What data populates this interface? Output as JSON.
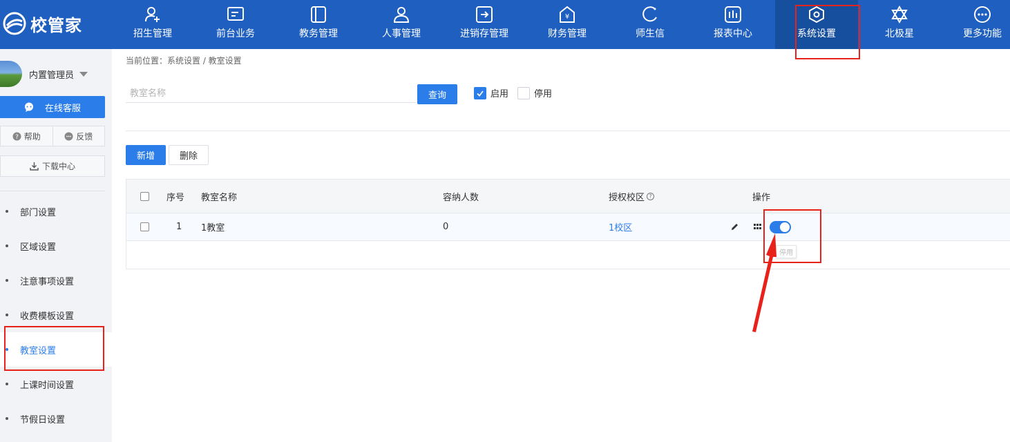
{
  "app": {
    "logo_text": "校管家"
  },
  "nav": [
    {
      "label": "招生管理",
      "icon": "user-add-icon"
    },
    {
      "label": "前台业务",
      "icon": "screen-icon"
    },
    {
      "label": "教务管理",
      "icon": "book-icon"
    },
    {
      "label": "人事管理",
      "icon": "person-icon"
    },
    {
      "label": "进销存管理",
      "icon": "arrow-box-icon"
    },
    {
      "label": "财务管理",
      "icon": "yuan-house-icon"
    },
    {
      "label": "师生信",
      "icon": "chat-circle-icon"
    },
    {
      "label": "报表中心",
      "icon": "bar-chart-icon"
    },
    {
      "label": "系统设置",
      "icon": "hexagon-gear-icon",
      "active": true
    },
    {
      "label": "北极星",
      "icon": "star-of-david-icon"
    },
    {
      "label": "更多功能",
      "icon": "more-dots-icon"
    }
  ],
  "sidebar": {
    "user_name": "内置管理员",
    "service_label": "在线客服",
    "help_label": "帮助",
    "feedback_label": "反馈",
    "download_label": "下载中心",
    "menu": [
      {
        "label": "部门设置"
      },
      {
        "label": "区域设置"
      },
      {
        "label": "注意事项设置"
      },
      {
        "label": "收费模板设置"
      },
      {
        "label": "教室设置",
        "active": true
      },
      {
        "label": "上课时间设置"
      },
      {
        "label": "节假日设置"
      }
    ]
  },
  "breadcrumb": "当前位置：系统设置 / 教室设置",
  "search": {
    "placeholder": "教室名称",
    "value": "",
    "query_label": "查询"
  },
  "filters": {
    "enabled_label": "启用",
    "enabled_checked": true,
    "disabled_label": "停用",
    "disabled_checked": false
  },
  "toolbar": {
    "add_label": "新增",
    "delete_label": "删除"
  },
  "table": {
    "columns": [
      "序号",
      "教室名称",
      "容纳人数",
      "授权校区",
      "操作"
    ],
    "rows": [
      {
        "index": "1",
        "name": "1教室",
        "capacity": "0",
        "campus": "1校区",
        "switch_on": true
      }
    ]
  },
  "tooltip": "停用",
  "colors": {
    "topbar": "#1e5fbf",
    "accent": "#2b7de9",
    "highlight": "#e8221b"
  }
}
